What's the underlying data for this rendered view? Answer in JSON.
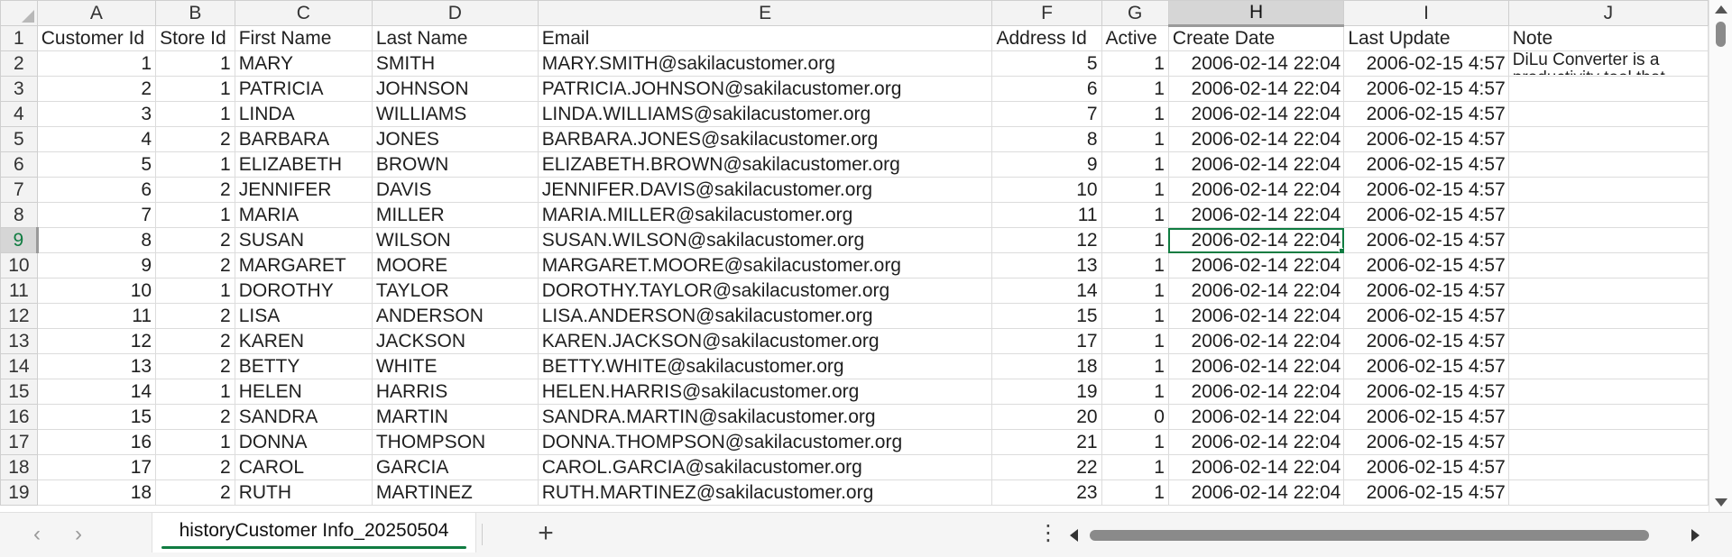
{
  "columns": [
    "A",
    "B",
    "C",
    "D",
    "E",
    "F",
    "G",
    "H",
    "I",
    "J"
  ],
  "selected_column": "H",
  "selected_row": 9,
  "header_row": [
    "Customer Id",
    "Store Id",
    "First Name",
    "Last Name",
    "Email",
    "Address Id",
    "Active",
    "Create Date",
    "Last Update",
    "Note"
  ],
  "note_text_line1": "DiLu Converter is a",
  "note_text_line2": "productivity tool that",
  "rows": [
    [
      "1",
      "1",
      "MARY",
      "SMITH",
      "MARY.SMITH@sakilacustomer.org",
      "5",
      "1",
      "2006-02-14 22:04",
      "2006-02-15 4:57"
    ],
    [
      "2",
      "1",
      "PATRICIA",
      "JOHNSON",
      "PATRICIA.JOHNSON@sakilacustomer.org",
      "6",
      "1",
      "2006-02-14 22:04",
      "2006-02-15 4:57"
    ],
    [
      "3",
      "1",
      "LINDA",
      "WILLIAMS",
      "LINDA.WILLIAMS@sakilacustomer.org",
      "7",
      "1",
      "2006-02-14 22:04",
      "2006-02-15 4:57"
    ],
    [
      "4",
      "2",
      "BARBARA",
      "JONES",
      "BARBARA.JONES@sakilacustomer.org",
      "8",
      "1",
      "2006-02-14 22:04",
      "2006-02-15 4:57"
    ],
    [
      "5",
      "1",
      "ELIZABETH",
      "BROWN",
      "ELIZABETH.BROWN@sakilacustomer.org",
      "9",
      "1",
      "2006-02-14 22:04",
      "2006-02-15 4:57"
    ],
    [
      "6",
      "2",
      "JENNIFER",
      "DAVIS",
      "JENNIFER.DAVIS@sakilacustomer.org",
      "10",
      "1",
      "2006-02-14 22:04",
      "2006-02-15 4:57"
    ],
    [
      "7",
      "1",
      "MARIA",
      "MILLER",
      "MARIA.MILLER@sakilacustomer.org",
      "11",
      "1",
      "2006-02-14 22:04",
      "2006-02-15 4:57"
    ],
    [
      "8",
      "2",
      "SUSAN",
      "WILSON",
      "SUSAN.WILSON@sakilacustomer.org",
      "12",
      "1",
      "2006-02-14 22:04",
      "2006-02-15 4:57"
    ],
    [
      "9",
      "2",
      "MARGARET",
      "MOORE",
      "MARGARET.MOORE@sakilacustomer.org",
      "13",
      "1",
      "2006-02-14 22:04",
      "2006-02-15 4:57"
    ],
    [
      "10",
      "1",
      "DOROTHY",
      "TAYLOR",
      "DOROTHY.TAYLOR@sakilacustomer.org",
      "14",
      "1",
      "2006-02-14 22:04",
      "2006-02-15 4:57"
    ],
    [
      "11",
      "2",
      "LISA",
      "ANDERSON",
      "LISA.ANDERSON@sakilacustomer.org",
      "15",
      "1",
      "2006-02-14 22:04",
      "2006-02-15 4:57"
    ],
    [
      "12",
      "2",
      "KAREN",
      "JACKSON",
      "KAREN.JACKSON@sakilacustomer.org",
      "17",
      "1",
      "2006-02-14 22:04",
      "2006-02-15 4:57"
    ],
    [
      "13",
      "2",
      "BETTY",
      "WHITE",
      "BETTY.WHITE@sakilacustomer.org",
      "18",
      "1",
      "2006-02-14 22:04",
      "2006-02-15 4:57"
    ],
    [
      "14",
      "1",
      "HELEN",
      "HARRIS",
      "HELEN.HARRIS@sakilacustomer.org",
      "19",
      "1",
      "2006-02-14 22:04",
      "2006-02-15 4:57"
    ],
    [
      "15",
      "2",
      "SANDRA",
      "MARTIN",
      "SANDRA.MARTIN@sakilacustomer.org",
      "20",
      "0",
      "2006-02-14 22:04",
      "2006-02-15 4:57"
    ],
    [
      "16",
      "1",
      "DONNA",
      "THOMPSON",
      "DONNA.THOMPSON@sakilacustomer.org",
      "21",
      "1",
      "2006-02-14 22:04",
      "2006-02-15 4:57"
    ],
    [
      "17",
      "2",
      "CAROL",
      "GARCIA",
      "CAROL.GARCIA@sakilacustomer.org",
      "22",
      "1",
      "2006-02-14 22:04",
      "2006-02-15 4:57"
    ],
    [
      "18",
      "2",
      "RUTH",
      "MARTINEZ",
      "RUTH.MARTINEZ@sakilacustomer.org",
      "23",
      "1",
      "2006-02-14 22:04",
      "2006-02-15 4:57"
    ]
  ],
  "sheet_tab": "historyCustomer Info_20250504",
  "nav_prev": "‹",
  "nav_next": "›",
  "add_sheet": "+",
  "more_options": "⋮",
  "accent_color": "#107c41"
}
